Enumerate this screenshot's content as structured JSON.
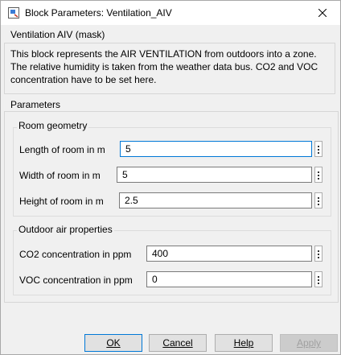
{
  "window": {
    "title": "Block Parameters: Ventilation_AIV"
  },
  "mask": {
    "title": "Ventilation AIV (mask)",
    "description": "This block represents the AIR VENTILATION from outdoors into a zone. The relative humidity is taken from the weather data bus. CO2 and VOC concentration have to be set here."
  },
  "parameters": {
    "label": "Parameters",
    "room_geometry": {
      "label": "Room geometry",
      "length_label": "Length of room in m",
      "length_value": "5",
      "width_label": "Width of room in m",
      "width_value": "5",
      "height_label": "Height of room in m",
      "height_value": "2.5"
    },
    "outdoor_air": {
      "label": "Outdoor air properties",
      "co2_label": "CO2 concentration in ppm",
      "co2_value": "400",
      "voc_label": "VOC concentration in ppm",
      "voc_value": "0"
    }
  },
  "buttons": {
    "ok": "OK",
    "cancel": "Cancel",
    "help": "Help",
    "apply": "Apply"
  },
  "icons": {
    "app": "simulink-block-icon",
    "close": "close-icon",
    "more": "vertical-ellipsis-icon"
  }
}
